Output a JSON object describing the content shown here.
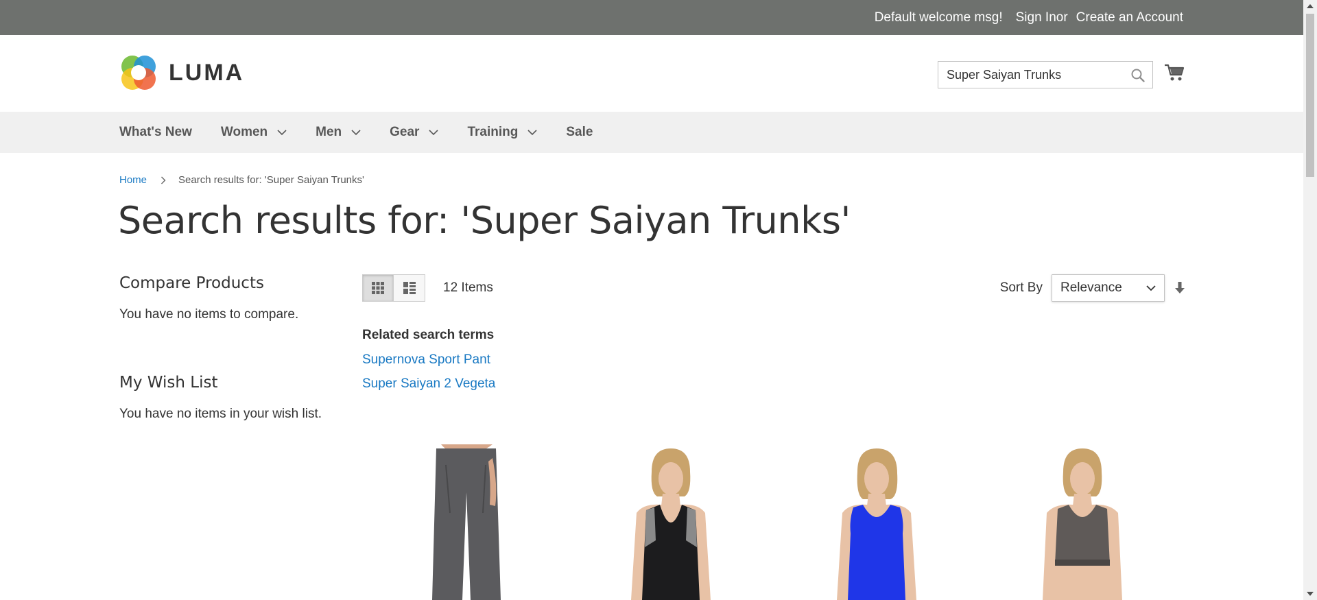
{
  "topbar": {
    "welcome": "Default welcome msg!",
    "sign_in": "Sign In",
    "or": "or",
    "create_account": "Create an Account"
  },
  "header": {
    "logo_text": "LUMA",
    "search_value": "Super Saiyan Trunks",
    "icons": {
      "search": "search-icon",
      "cart": "cart-icon"
    }
  },
  "nav": {
    "items": [
      {
        "label": "What's New",
        "has_dropdown": false
      },
      {
        "label": "Women",
        "has_dropdown": true
      },
      {
        "label": "Men",
        "has_dropdown": true
      },
      {
        "label": "Gear",
        "has_dropdown": true
      },
      {
        "label": "Training",
        "has_dropdown": true
      },
      {
        "label": "Sale",
        "has_dropdown": false
      }
    ]
  },
  "breadcrumb": {
    "home": "Home",
    "current": "Search results for: 'Super Saiyan Trunks'"
  },
  "page_title": "Search results for: 'Super Saiyan Trunks'",
  "sidebar": {
    "compare_title": "Compare Products",
    "compare_text": "You have no items to compare.",
    "wishlist_title": "My Wish List",
    "wishlist_text": "You have no items in your wish list."
  },
  "toolbar": {
    "view_modes": [
      "grid",
      "list"
    ],
    "active_mode": "grid",
    "amount": "12 Items",
    "sort_label": "Sort By",
    "sort_value": "Relevance",
    "sort_direction_icon": "arrow-down-icon"
  },
  "related": {
    "heading": "Related search terms",
    "terms": [
      "Supernova Sport Pant",
      "Super Saiyan 2 Vegeta"
    ]
  },
  "products": [
    {
      "kind": "pants",
      "color": "#5a5a5c"
    },
    {
      "kind": "tank-black",
      "color": "#1c1c1e"
    },
    {
      "kind": "tank-blue",
      "color": "#1f36e8"
    },
    {
      "kind": "bra-gray",
      "color": "#5f5a58"
    }
  ],
  "colors": {
    "topbar_bg": "#6e716e",
    "nav_bg": "#f0f0f0",
    "link": "#1979c3"
  }
}
